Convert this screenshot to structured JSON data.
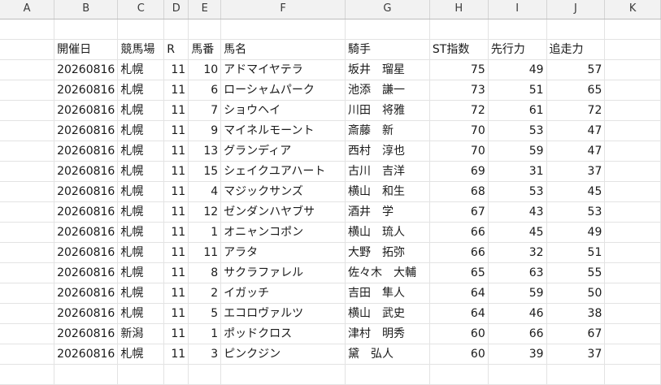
{
  "columns": [
    "A",
    "B",
    "C",
    "D",
    "E",
    "F",
    "G",
    "H",
    "I",
    "J",
    "K"
  ],
  "headers": {
    "date": "開催日",
    "course": "競馬場",
    "race": "R",
    "number": "馬番",
    "horse": "馬名",
    "jockey": "騎手",
    "st": "ST指数",
    "early": "先行力",
    "late": "追走力"
  },
  "rows": [
    {
      "date": "20260816",
      "course": "札幌",
      "race": "11",
      "number": "10",
      "horse": "アドマイヤテラ",
      "jockey": "坂井　瑠星",
      "st": "75",
      "early": "49",
      "late": "57"
    },
    {
      "date": "20260816",
      "course": "札幌",
      "race": "11",
      "number": "6",
      "horse": "ローシャムパーク",
      "jockey": "池添　謙一",
      "st": "73",
      "early": "51",
      "late": "65"
    },
    {
      "date": "20260816",
      "course": "札幌",
      "race": "11",
      "number": "7",
      "horse": "ショウヘイ",
      "jockey": "川田　将雅",
      "st": "72",
      "early": "61",
      "late": "72"
    },
    {
      "date": "20260816",
      "course": "札幌",
      "race": "11",
      "number": "9",
      "horse": "マイネルモーント",
      "jockey": "斎藤　新",
      "st": "70",
      "early": "53",
      "late": "47"
    },
    {
      "date": "20260816",
      "course": "札幌",
      "race": "11",
      "number": "13",
      "horse": "グランディア",
      "jockey": "西村　淳也",
      "st": "70",
      "early": "59",
      "late": "47"
    },
    {
      "date": "20260816",
      "course": "札幌",
      "race": "11",
      "number": "15",
      "horse": "シェイクユアハート",
      "jockey": "古川　吉洋",
      "st": "69",
      "early": "31",
      "late": "37"
    },
    {
      "date": "20260816",
      "course": "札幌",
      "race": "11",
      "number": "4",
      "horse": "マジックサンズ",
      "jockey": "横山　和生",
      "st": "68",
      "early": "53",
      "late": "45"
    },
    {
      "date": "20260816",
      "course": "札幌",
      "race": "11",
      "number": "12",
      "horse": "ゼンダンハヤブサ",
      "jockey": "酒井　学",
      "st": "67",
      "early": "43",
      "late": "53"
    },
    {
      "date": "20260816",
      "course": "札幌",
      "race": "11",
      "number": "1",
      "horse": "オニャンコポン",
      "jockey": "横山　琉人",
      "st": "66",
      "early": "45",
      "late": "49"
    },
    {
      "date": "20260816",
      "course": "札幌",
      "race": "11",
      "number": "11",
      "horse": "アラタ",
      "jockey": "大野　拓弥",
      "st": "66",
      "early": "32",
      "late": "51"
    },
    {
      "date": "20260816",
      "course": "札幌",
      "race": "11",
      "number": "8",
      "horse": "サクラファレル",
      "jockey": "佐々木　大輔",
      "st": "65",
      "early": "63",
      "late": "55"
    },
    {
      "date": "20260816",
      "course": "札幌",
      "race": "11",
      "number": "2",
      "horse": "イガッチ",
      "jockey": "吉田　隼人",
      "st": "64",
      "early": "59",
      "late": "50"
    },
    {
      "date": "20260816",
      "course": "札幌",
      "race": "11",
      "number": "5",
      "horse": "エコロヴァルツ",
      "jockey": "横山　武史",
      "st": "64",
      "early": "46",
      "late": "38"
    },
    {
      "date": "20260816",
      "course": "新潟",
      "race": "11",
      "number": "1",
      "horse": "ポッドクロス",
      "jockey": "津村　明秀",
      "st": "60",
      "early": "66",
      "late": "67"
    },
    {
      "date": "20260816",
      "course": "札幌",
      "race": "11",
      "number": "3",
      "horse": "ピンクジン",
      "jockey": "黛　弘人",
      "st": "60",
      "early": "39",
      "late": "37"
    }
  ]
}
